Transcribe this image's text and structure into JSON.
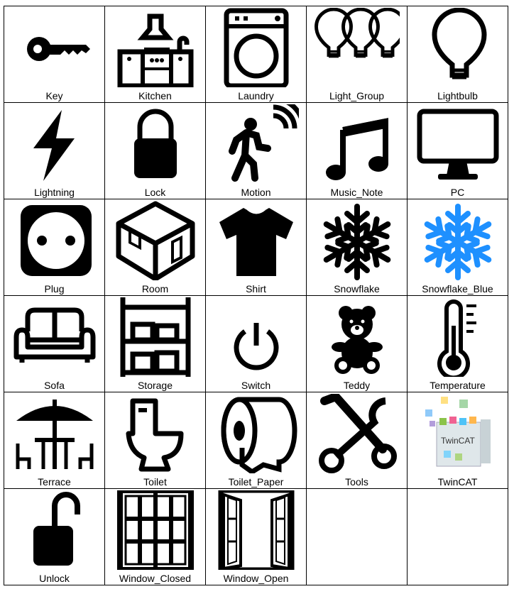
{
  "icons": [
    {
      "label": "Key",
      "icon": "key"
    },
    {
      "label": "Kitchen",
      "icon": "kitchen"
    },
    {
      "label": "Laundry",
      "icon": "laundry"
    },
    {
      "label": "Light_Group",
      "icon": "light_group"
    },
    {
      "label": "Lightbulb",
      "icon": "lightbulb"
    },
    {
      "label": "Lightning",
      "icon": "lightning"
    },
    {
      "label": "Lock",
      "icon": "lock"
    },
    {
      "label": "Motion",
      "icon": "motion"
    },
    {
      "label": "Music_Note",
      "icon": "music_note"
    },
    {
      "label": "PC",
      "icon": "pc"
    },
    {
      "label": "Plug",
      "icon": "plug"
    },
    {
      "label": "Room",
      "icon": "room"
    },
    {
      "label": "Shirt",
      "icon": "shirt"
    },
    {
      "label": "Snowflake",
      "icon": "snowflake"
    },
    {
      "label": "Snowflake_Blue",
      "icon": "snowflake_blue",
      "color": "#1E90FF"
    },
    {
      "label": "Sofa",
      "icon": "sofa"
    },
    {
      "label": "Storage",
      "icon": "storage"
    },
    {
      "label": "Switch",
      "icon": "switch"
    },
    {
      "label": "Teddy",
      "icon": "teddy"
    },
    {
      "label": "Temperature",
      "icon": "temperature"
    },
    {
      "label": "Terrace",
      "icon": "terrace"
    },
    {
      "label": "Toilet",
      "icon": "toilet"
    },
    {
      "label": "Toilet_Paper",
      "icon": "toilet_paper"
    },
    {
      "label": "Tools",
      "icon": "tools"
    },
    {
      "label": "TwinCAT",
      "icon": "twincat"
    },
    {
      "label": "Unlock",
      "icon": "unlock"
    },
    {
      "label": "Window_Closed",
      "icon": "window_closed"
    },
    {
      "label": "Window_Open",
      "icon": "window_open"
    },
    {
      "label": "",
      "icon": ""
    },
    {
      "label": "",
      "icon": ""
    }
  ]
}
